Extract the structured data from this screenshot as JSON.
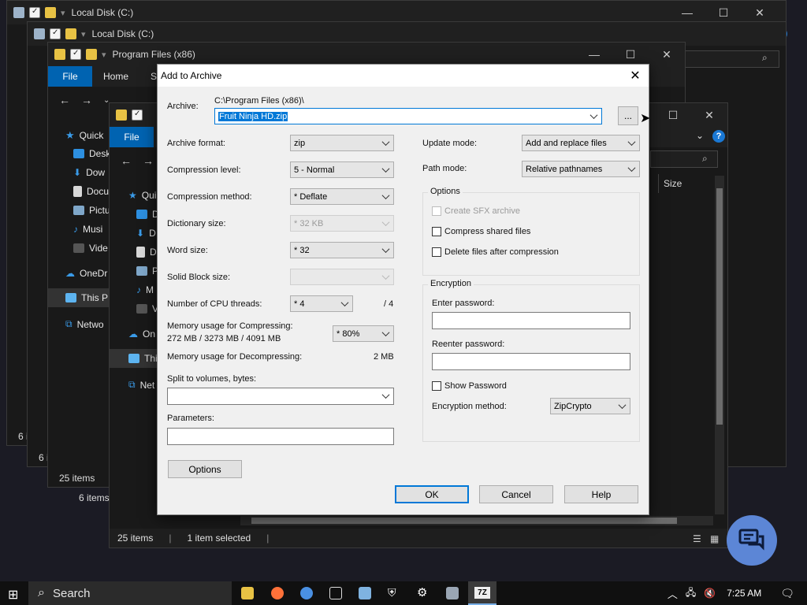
{
  "explorer": {
    "win1_title": "Local Disk (C:)",
    "win2_title": "Local Disk (C:)",
    "win3_title": "Program Files (x86)",
    "tab_file": "File",
    "tab_home": "Home",
    "tab_share_partial": "Sh",
    "quick_access": "Quick",
    "sidebar_desk": "Desk",
    "sidebar_down": "Dow",
    "sidebar_docu": "Docu",
    "sidebar_pict": "Pictu",
    "sidebar_musi": "Musi",
    "sidebar_vide": "Vide",
    "sidebar_onedrive": "OneDr",
    "sidebar_thispc": "This P",
    "sidebar_network": "Netwo",
    "sidebar2_qui": "Qui",
    "sidebar2_d1": "D",
    "sidebar2_d2": "D",
    "sidebar2_d3": "D",
    "sidebar2_p": "P",
    "sidebar2_m": "M",
    "sidebar2_v": "V",
    "sidebar2_on": "On",
    "sidebar2_thi": "Thi",
    "sidebar2_net": "Net",
    "size_column": "Size",
    "status_items_a": "6 i",
    "status_items_b": "6 i",
    "status_items_c": "25 items",
    "status_items_d": "6 items",
    "status_items_e": "25 items",
    "status_selected": "1 item selected"
  },
  "dialog": {
    "title": "Add to Archive",
    "archive_label": "Archive:",
    "archive_path": "C:\\Program Files (x86)\\",
    "archive_name": "Fruit Ninja HD.zip",
    "browse_label": "...",
    "archive_format_label": "Archive format:",
    "archive_format_value": "zip",
    "compression_level_label": "Compression level:",
    "compression_level_value": "5 - Normal",
    "compression_method_label": "Compression method:",
    "compression_method_value": "* Deflate",
    "dictionary_size_label": "Dictionary size:",
    "dictionary_size_value": "* 32 KB",
    "word_size_label": "Word size:",
    "word_size_value": "* 32",
    "solid_block_label": "Solid Block size:",
    "cpu_threads_label": "Number of CPU threads:",
    "cpu_threads_value": "* 4",
    "cpu_threads_max": "/ 4",
    "mem_compress_label": "Memory usage for Compressing:",
    "mem_compress_value": "272 MB / 3273 MB / 4091 MB",
    "mem_percent_value": "* 80%",
    "mem_decompress_label": "Memory usage for Decompressing:",
    "mem_decompress_value": "2 MB",
    "split_label": "Split to volumes, bytes:",
    "parameters_label": "Parameters:",
    "options_button": "Options",
    "update_mode_label": "Update mode:",
    "update_mode_value": "Add and replace files",
    "path_mode_label": "Path mode:",
    "path_mode_value": "Relative pathnames",
    "options_group": "Options",
    "create_sfx": "Create SFX archive",
    "compress_shared": "Compress shared files",
    "delete_after": "Delete files after compression",
    "encryption_group": "Encryption",
    "enter_password_label": "Enter password:",
    "reenter_password_label": "Reenter password:",
    "show_password": "Show Password",
    "encryption_method_label": "Encryption method:",
    "encryption_method_value": "ZipCrypto",
    "ok_button": "OK",
    "cancel_button": "Cancel",
    "help_button": "Help"
  },
  "taskbar": {
    "search_label": "Search",
    "clock": "7:25 AM"
  },
  "colors": {
    "accent": "#0078d7",
    "file_tab": "#0063b1",
    "chat_fab": "#5c86d6"
  }
}
